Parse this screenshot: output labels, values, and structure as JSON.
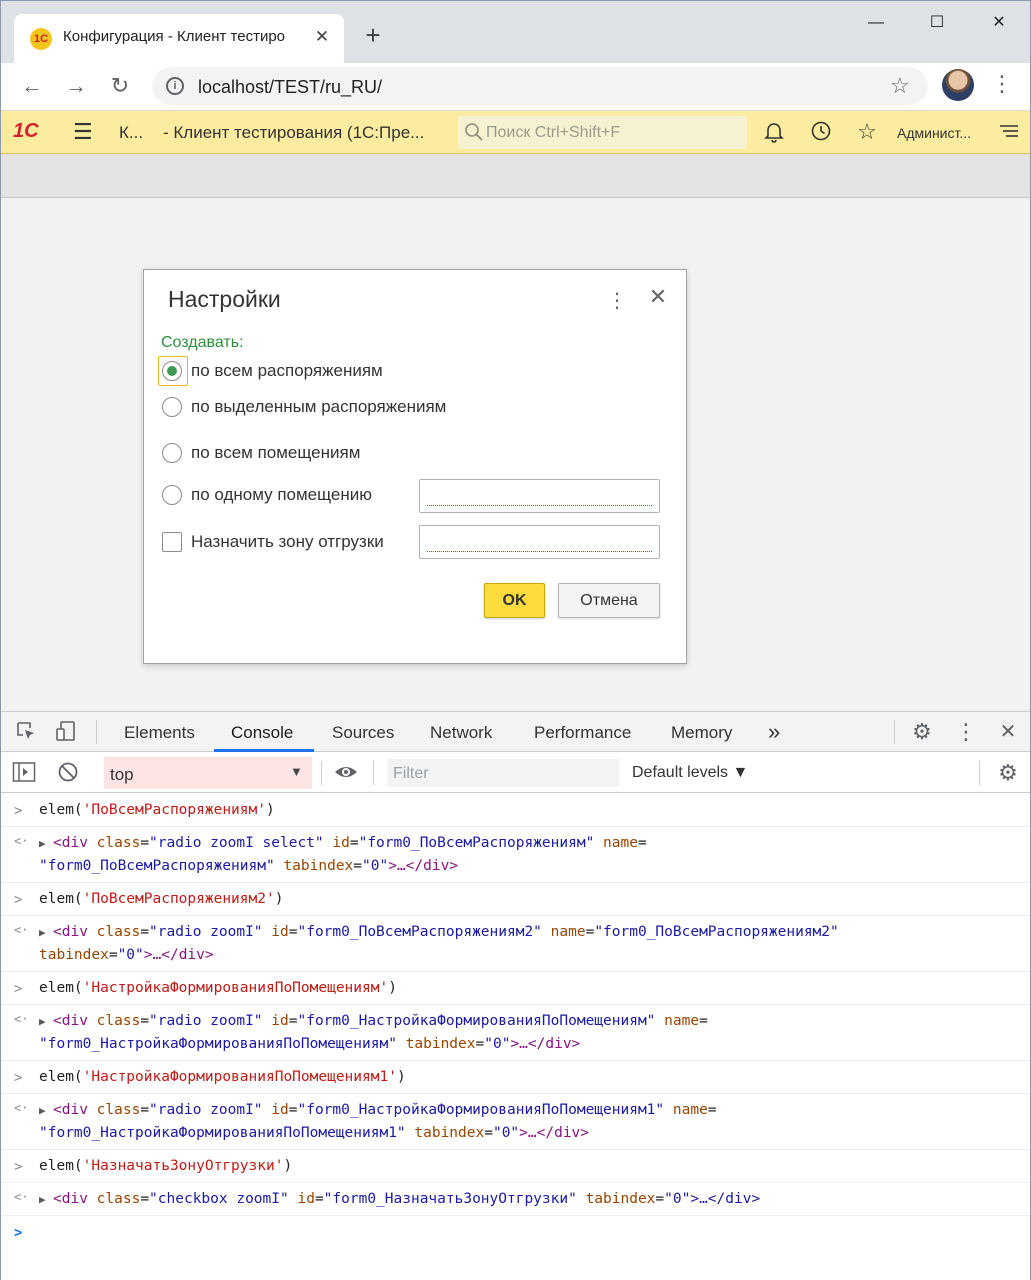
{
  "browser": {
    "tab_title": "Конфигурация - Клиент тестиро",
    "tab_favicon": "1С",
    "tab_close": "✕",
    "new_tab": "+",
    "url": "localhost/TEST/ru_RU/",
    "win_minimize": "—",
    "win_maximize": "☐",
    "win_close": "✕"
  },
  "app": {
    "logo": "1С",
    "short_title": "К...",
    "title": "- Клиент тестирования (1С:Пре...",
    "search_placeholder": "Поиск Ctrl+Shift+F",
    "user": "Админист..."
  },
  "dialog": {
    "title": "Настройки",
    "group_label": "Создавать:",
    "options": [
      {
        "label": "по всем распоряжениям",
        "checked": true
      },
      {
        "label": "по выделенным распоряжениям",
        "checked": false
      },
      {
        "label": "по всем помещениям",
        "checked": false
      },
      {
        "label": "по одному помещению",
        "checked": false
      }
    ],
    "checkbox_label": "Назначить зону отгрузки",
    "ok_label": "OK",
    "cancel_label": "Отмена"
  },
  "devtools": {
    "tabs": [
      "Elements",
      "Console",
      "Sources",
      "Network",
      "Performance",
      "Memory"
    ],
    "more_tabs": "»",
    "active_tab": "Console",
    "context": "top",
    "filter_placeholder": "Filter",
    "levels": "Default levels ▼"
  },
  "console": [
    {
      "cmd_fn": "elem(",
      "cmd_arg": "'ПоВсемРаспоряжениям'",
      "cmd_close": ")",
      "res_open": "<div",
      "res_line1": [
        {
          "k": "class",
          "v": "\"radio zoomI select\""
        },
        {
          "k": "id",
          "v": "\"form0_ПоВсемРаспоряжениям\""
        },
        {
          "k": "name",
          "v": "="
        }
      ],
      "res_line2": "\"form0_ПоВсемРаспоряжениям\"",
      "res_tail": "tabindex=\"0\">…</div>"
    },
    {
      "cmd_fn": "elem(",
      "cmd_arg": "'ПоВсемРаспоряжениям2'",
      "cmd_close": ")",
      "res_open": "<div",
      "res_line1": [
        {
          "k": "class",
          "v": "\"radio zoomI\""
        },
        {
          "k": "id",
          "v": "\"form0_ПоВсемРаспоряжениям2\""
        },
        {
          "k": "name",
          "v": "=\"form0_ПоВсемРаспоряжениям2\""
        }
      ],
      "res_line2": "",
      "res_tail": "tabindex=\"0\">…</div>"
    },
    {
      "cmd_fn": "elem(",
      "cmd_arg": "'НастройкаФормированияПоПомещениям'",
      "cmd_close": ")",
      "res_open": "<div",
      "res_line1": [
        {
          "k": "class",
          "v": "\"radio zoomI\""
        },
        {
          "k": "id",
          "v": "\"form0_НастройкаФормированияПоПомещениям\""
        },
        {
          "k": "name",
          "v": "="
        }
      ],
      "res_line2": "\"form0_НастройкаФормированияПоПомещениям\"",
      "res_tail": "tabindex=\"0\">…</div>"
    },
    {
      "cmd_fn": "elem(",
      "cmd_arg": "'НастройкаФормированияПоПомещениям1'",
      "cmd_close": ")",
      "res_open": "<div",
      "res_line1": [
        {
          "k": "class",
          "v": "\"radio zoomI\""
        },
        {
          "k": "id",
          "v": "\"form0_НастройкаФормированияПоПомещениям1\""
        },
        {
          "k": "name",
          "v": "="
        }
      ],
      "res_line2": "\"form0_НастройкаФормированияПоПомещениям1\"",
      "res_tail": "tabindex=\"0\">…</div>"
    },
    {
      "cmd_fn": "elem(",
      "cmd_arg": "'НазначатьЗонуОтгрузки'",
      "cmd_close": ")",
      "res_open": "<div",
      "res_line1": [
        {
          "k": "class",
          "v": "\"checkbox zoomI\""
        },
        {
          "k": "id",
          "v": "\"form0_НазначатьЗонуОтгрузки\""
        },
        {
          "k": "tabindex",
          "v": "\"0\">…</div>"
        }
      ],
      "res_line2": "",
      "res_tail": ""
    }
  ]
}
